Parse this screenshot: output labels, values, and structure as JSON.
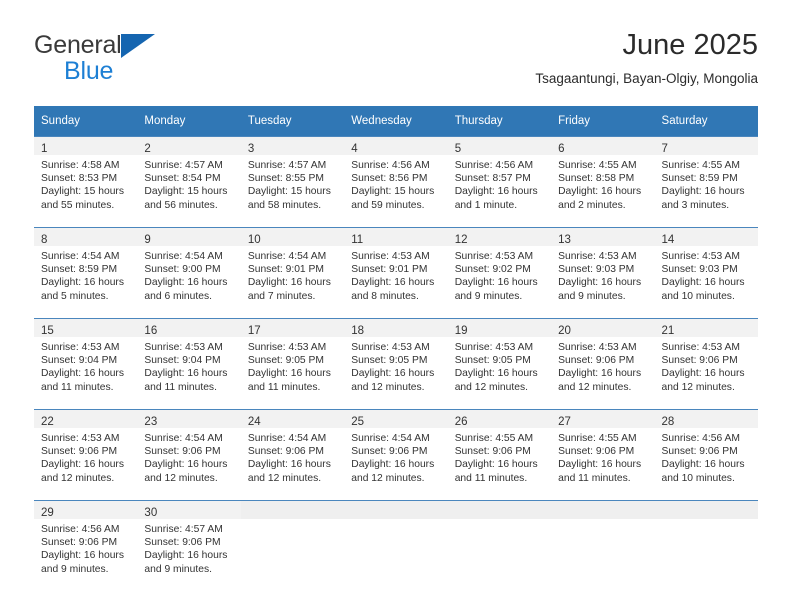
{
  "brand": {
    "line1": "General",
    "line2": "Blue",
    "logo_icon": "triangle-flag-icon"
  },
  "header": {
    "title": "June 2025",
    "subtitle": "Tsagaantungi, Bayan-Olgiy, Mongolia"
  },
  "theme": {
    "header_blue": "#3077b5",
    "brand_blue": "#1d7fd4",
    "logo_blue": "#1565b0",
    "daynum_band": "#f2f2f2",
    "row_border": "#4a86bd"
  },
  "weekdays": [
    "Sunday",
    "Monday",
    "Tuesday",
    "Wednesday",
    "Thursday",
    "Friday",
    "Saturday"
  ],
  "weeks": [
    [
      {
        "day": "1",
        "sunrise": "Sunrise: 4:58 AM",
        "sunset": "Sunset: 8:53 PM",
        "daylight1": "Daylight: 15 hours",
        "daylight2": "and 55 minutes."
      },
      {
        "day": "2",
        "sunrise": "Sunrise: 4:57 AM",
        "sunset": "Sunset: 8:54 PM",
        "daylight1": "Daylight: 15 hours",
        "daylight2": "and 56 minutes."
      },
      {
        "day": "3",
        "sunrise": "Sunrise: 4:57 AM",
        "sunset": "Sunset: 8:55 PM",
        "daylight1": "Daylight: 15 hours",
        "daylight2": "and 58 minutes."
      },
      {
        "day": "4",
        "sunrise": "Sunrise: 4:56 AM",
        "sunset": "Sunset: 8:56 PM",
        "daylight1": "Daylight: 15 hours",
        "daylight2": "and 59 minutes."
      },
      {
        "day": "5",
        "sunrise": "Sunrise: 4:56 AM",
        "sunset": "Sunset: 8:57 PM",
        "daylight1": "Daylight: 16 hours",
        "daylight2": "and 1 minute."
      },
      {
        "day": "6",
        "sunrise": "Sunrise: 4:55 AM",
        "sunset": "Sunset: 8:58 PM",
        "daylight1": "Daylight: 16 hours",
        "daylight2": "and 2 minutes."
      },
      {
        "day": "7",
        "sunrise": "Sunrise: 4:55 AM",
        "sunset": "Sunset: 8:59 PM",
        "daylight1": "Daylight: 16 hours",
        "daylight2": "and 3 minutes."
      }
    ],
    [
      {
        "day": "8",
        "sunrise": "Sunrise: 4:54 AM",
        "sunset": "Sunset: 8:59 PM",
        "daylight1": "Daylight: 16 hours",
        "daylight2": "and 5 minutes."
      },
      {
        "day": "9",
        "sunrise": "Sunrise: 4:54 AM",
        "sunset": "Sunset: 9:00 PM",
        "daylight1": "Daylight: 16 hours",
        "daylight2": "and 6 minutes."
      },
      {
        "day": "10",
        "sunrise": "Sunrise: 4:54 AM",
        "sunset": "Sunset: 9:01 PM",
        "daylight1": "Daylight: 16 hours",
        "daylight2": "and 7 minutes."
      },
      {
        "day": "11",
        "sunrise": "Sunrise: 4:53 AM",
        "sunset": "Sunset: 9:01 PM",
        "daylight1": "Daylight: 16 hours",
        "daylight2": "and 8 minutes."
      },
      {
        "day": "12",
        "sunrise": "Sunrise: 4:53 AM",
        "sunset": "Sunset: 9:02 PM",
        "daylight1": "Daylight: 16 hours",
        "daylight2": "and 9 minutes."
      },
      {
        "day": "13",
        "sunrise": "Sunrise: 4:53 AM",
        "sunset": "Sunset: 9:03 PM",
        "daylight1": "Daylight: 16 hours",
        "daylight2": "and 9 minutes."
      },
      {
        "day": "14",
        "sunrise": "Sunrise: 4:53 AM",
        "sunset": "Sunset: 9:03 PM",
        "daylight1": "Daylight: 16 hours",
        "daylight2": "and 10 minutes."
      }
    ],
    [
      {
        "day": "15",
        "sunrise": "Sunrise: 4:53 AM",
        "sunset": "Sunset: 9:04 PM",
        "daylight1": "Daylight: 16 hours",
        "daylight2": "and 11 minutes."
      },
      {
        "day": "16",
        "sunrise": "Sunrise: 4:53 AM",
        "sunset": "Sunset: 9:04 PM",
        "daylight1": "Daylight: 16 hours",
        "daylight2": "and 11 minutes."
      },
      {
        "day": "17",
        "sunrise": "Sunrise: 4:53 AM",
        "sunset": "Sunset: 9:05 PM",
        "daylight1": "Daylight: 16 hours",
        "daylight2": "and 11 minutes."
      },
      {
        "day": "18",
        "sunrise": "Sunrise: 4:53 AM",
        "sunset": "Sunset: 9:05 PM",
        "daylight1": "Daylight: 16 hours",
        "daylight2": "and 12 minutes."
      },
      {
        "day": "19",
        "sunrise": "Sunrise: 4:53 AM",
        "sunset": "Sunset: 9:05 PM",
        "daylight1": "Daylight: 16 hours",
        "daylight2": "and 12 minutes."
      },
      {
        "day": "20",
        "sunrise": "Sunrise: 4:53 AM",
        "sunset": "Sunset: 9:06 PM",
        "daylight1": "Daylight: 16 hours",
        "daylight2": "and 12 minutes."
      },
      {
        "day": "21",
        "sunrise": "Sunrise: 4:53 AM",
        "sunset": "Sunset: 9:06 PM",
        "daylight1": "Daylight: 16 hours",
        "daylight2": "and 12 minutes."
      }
    ],
    [
      {
        "day": "22",
        "sunrise": "Sunrise: 4:53 AM",
        "sunset": "Sunset: 9:06 PM",
        "daylight1": "Daylight: 16 hours",
        "daylight2": "and 12 minutes."
      },
      {
        "day": "23",
        "sunrise": "Sunrise: 4:54 AM",
        "sunset": "Sunset: 9:06 PM",
        "daylight1": "Daylight: 16 hours",
        "daylight2": "and 12 minutes."
      },
      {
        "day": "24",
        "sunrise": "Sunrise: 4:54 AM",
        "sunset": "Sunset: 9:06 PM",
        "daylight1": "Daylight: 16 hours",
        "daylight2": "and 12 minutes."
      },
      {
        "day": "25",
        "sunrise": "Sunrise: 4:54 AM",
        "sunset": "Sunset: 9:06 PM",
        "daylight1": "Daylight: 16 hours",
        "daylight2": "and 12 minutes."
      },
      {
        "day": "26",
        "sunrise": "Sunrise: 4:55 AM",
        "sunset": "Sunset: 9:06 PM",
        "daylight1": "Daylight: 16 hours",
        "daylight2": "and 11 minutes."
      },
      {
        "day": "27",
        "sunrise": "Sunrise: 4:55 AM",
        "sunset": "Sunset: 9:06 PM",
        "daylight1": "Daylight: 16 hours",
        "daylight2": "and 11 minutes."
      },
      {
        "day": "28",
        "sunrise": "Sunrise: 4:56 AM",
        "sunset": "Sunset: 9:06 PM",
        "daylight1": "Daylight: 16 hours",
        "daylight2": "and 10 minutes."
      }
    ],
    [
      {
        "day": "29",
        "sunrise": "Sunrise: 4:56 AM",
        "sunset": "Sunset: 9:06 PM",
        "daylight1": "Daylight: 16 hours",
        "daylight2": "and 9 minutes."
      },
      {
        "day": "30",
        "sunrise": "Sunrise: 4:57 AM",
        "sunset": "Sunset: 9:06 PM",
        "daylight1": "Daylight: 16 hours",
        "daylight2": "and 9 minutes."
      },
      {
        "day": "",
        "sunrise": "",
        "sunset": "",
        "daylight1": "",
        "daylight2": ""
      },
      {
        "day": "",
        "sunrise": "",
        "sunset": "",
        "daylight1": "",
        "daylight2": ""
      },
      {
        "day": "",
        "sunrise": "",
        "sunset": "",
        "daylight1": "",
        "daylight2": ""
      },
      {
        "day": "",
        "sunrise": "",
        "sunset": "",
        "daylight1": "",
        "daylight2": ""
      },
      {
        "day": "",
        "sunrise": "",
        "sunset": "",
        "daylight1": "",
        "daylight2": ""
      }
    ]
  ]
}
